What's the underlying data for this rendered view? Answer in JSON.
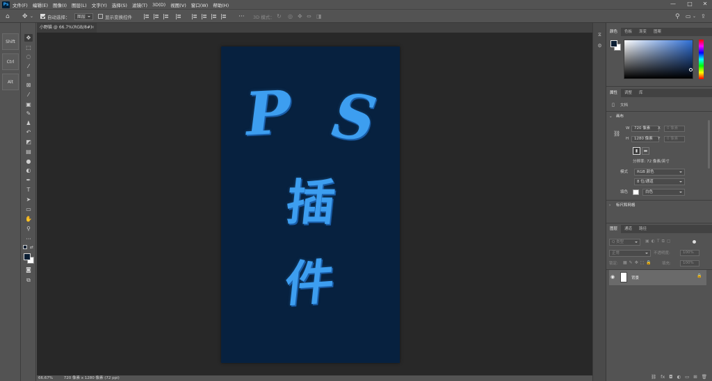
{
  "app": {
    "logo": "Ps"
  },
  "menu": {
    "items": [
      "文件(F)",
      "编辑(E)",
      "图像(I)",
      "图层(L)",
      "文字(Y)",
      "选择(S)",
      "滤镜(T)",
      "3D(D)",
      "视图(V)",
      "窗口(W)",
      "帮助(H)"
    ]
  },
  "window_controls": {
    "minimize": "—",
    "maximize": "□",
    "close": "✕"
  },
  "options": {
    "auto_select_label": "自动选择：",
    "auto_select_value": "图层",
    "show_transform_label": "显示变换控件",
    "mode_3d_label": "3D 模式："
  },
  "left_keys": [
    "Shift",
    "Ctrl",
    "Alt"
  ],
  "document": {
    "tab_title": "小野猫 @ 66.7%(RGB/8#)",
    "tab_close": "×",
    "status_zoom": "66.67%",
    "status_info": "720 像素 x 1280 像素 (72 ppi)",
    "canvas_color": "#07213f",
    "art_color": "#3d9ef0",
    "art_lines": [
      "P",
      "S",
      "插",
      "件"
    ]
  },
  "color_panel": {
    "tabs": [
      "颜色",
      "色板",
      "渐变",
      "图案"
    ],
    "foreground": "#0b1e33",
    "background": "#ffffff",
    "hue": "#2f6fd6"
  },
  "properties_panel": {
    "tabs": [
      "属性",
      "调整",
      "库"
    ],
    "doc_label": "文档",
    "canvas_section": "画布",
    "w_label": "W",
    "w_value": "720 像素",
    "x_label": "X",
    "x_value": "0 像素",
    "h_label": "H",
    "h_value": "1280 像素",
    "y_label": "Y",
    "y_value": "0 像素",
    "resolution": "分辨率: 72 像素/英寸",
    "mode_label": "模式",
    "mode_value": "RGB 颜色",
    "depth_value": "8 位/通道",
    "fill_label": "填色",
    "fill_value": "白色",
    "rulers_section": "标尺和网格"
  },
  "layers_panel": {
    "tabs": [
      "图层",
      "通道",
      "路径"
    ],
    "filter_placeholder": "Q 类型",
    "blend_mode": "正常",
    "opacity_label": "不透明度:",
    "opacity_value": "100%",
    "lock_label": "锁定:",
    "fill_label": "填充:",
    "fill_value": "100%",
    "layers": [
      {
        "name": "背景",
        "visible": true,
        "locked": true
      }
    ]
  }
}
